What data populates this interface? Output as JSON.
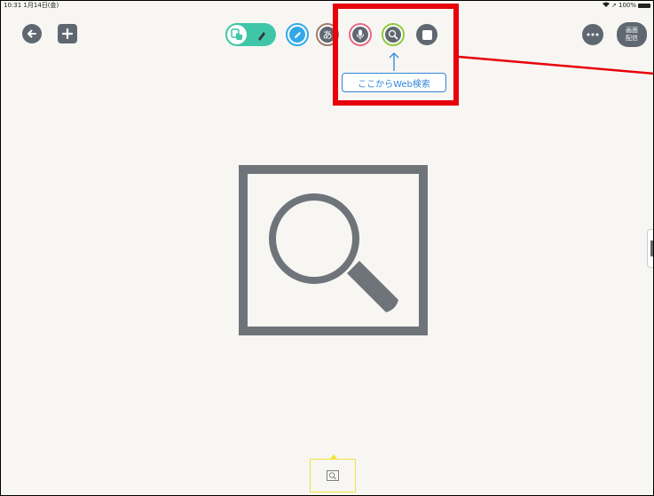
{
  "status_bar": {
    "time": "10:31",
    "date": "1月14日(金)",
    "battery": "100%"
  },
  "toolbar": {
    "back_icon": "arrow-left-icon",
    "add_icon": "plus-icon",
    "tools": [
      {
        "name": "select-touch",
        "icon": "hand-pointer-icon"
      },
      {
        "name": "pen",
        "icon": "pen-icon",
        "ring": "#33a8e8"
      },
      {
        "name": "text",
        "label": "あ",
        "ring": "#a07a68"
      },
      {
        "name": "voice",
        "icon": "microphone-icon",
        "ring": "#e66a87"
      },
      {
        "name": "web-search",
        "icon": "search-icon",
        "ring": "#8fc93a"
      },
      {
        "name": "shape",
        "icon": "square-icon"
      }
    ],
    "more_icon": "more-dots-icon",
    "stream_label_line1": "画面",
    "stream_label_line2": "配信"
  },
  "annotation": {
    "tooltip_text": "ここからWeb検索",
    "highlight_color": "#e8000b",
    "tooltip_color": "#2f86d6"
  },
  "canvas": {
    "center_icon": "web-search-card-icon"
  },
  "page_thumbnail": {
    "icon": "search-card-thumbnail-icon",
    "highlight_color": "#f1e43b"
  },
  "colors": {
    "button_gray": "#5f6870",
    "accent_teal": "#3fc6a8",
    "background": "#f7f6f3"
  }
}
